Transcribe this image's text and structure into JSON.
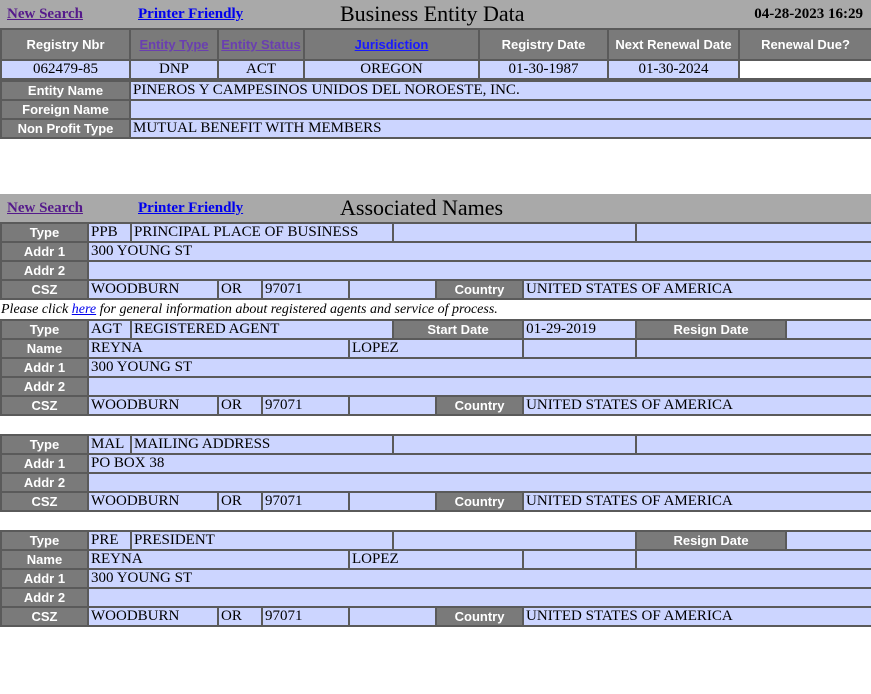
{
  "entity_section": {
    "new_search": "New Search",
    "printer_friendly": "Printer Friendly",
    "title": "Business Entity Data",
    "timestamp": "04-28-2023 16:29",
    "headers": {
      "registry_nbr": "Registry Nbr",
      "entity_type": "Entity Type",
      "entity_status": "Entity Status",
      "jurisdiction": "Jurisdiction",
      "registry_date": "Registry Date",
      "next_renewal_date": "Next Renewal Date",
      "renewal_due": "Renewal Due?"
    },
    "values": {
      "registry_nbr": "062479-85",
      "entity_type": "DNP",
      "entity_status": "ACT",
      "jurisdiction": "OREGON",
      "registry_date": "01-30-1987",
      "next_renewal_date": "01-30-2024",
      "renewal_due": ""
    },
    "entity_name_label": "Entity Name",
    "entity_name": "PINEROS Y CAMPESINOS UNIDOS DEL NOROESTE, INC.",
    "foreign_name_label": "Foreign Name",
    "foreign_name": "",
    "non_profit_type_label": "Non Profit Type",
    "non_profit_type": "MUTUAL BENEFIT WITH MEMBERS"
  },
  "associated_section": {
    "new_search": "New Search",
    "printer_friendly": "Printer Friendly",
    "title": "Associated Names"
  },
  "labels": {
    "type": "Type",
    "name": "Name",
    "addr1": "Addr 1",
    "addr2": "Addr 2",
    "csz": "CSZ",
    "country": "Country",
    "start_date": "Start Date",
    "resign_date": "Resign Date"
  },
  "agent_note": {
    "before": "Please click ",
    "link": "here",
    "after": " for general information about registered agents and service of process."
  },
  "ppb": {
    "code": "PPB",
    "desc": "PRINCIPAL PLACE OF BUSINESS",
    "addr1": "300 YOUNG ST",
    "addr2": "",
    "city": "WOODBURN",
    "state": "OR",
    "zip": "97071",
    "country": "UNITED STATES OF AMERICA"
  },
  "agt": {
    "code": "AGT",
    "desc": "REGISTERED AGENT",
    "start_date": "01-29-2019",
    "resign_date": "",
    "first_name": "REYNA",
    "last_name": "LOPEZ",
    "addr1": "300 YOUNG ST",
    "addr2": "",
    "city": "WOODBURN",
    "state": "OR",
    "zip": "97071",
    "country": "UNITED STATES OF AMERICA"
  },
  "mal": {
    "code": "MAL",
    "desc": "MAILING ADDRESS",
    "addr1": "PO BOX 38",
    "addr2": "",
    "city": "WOODBURN",
    "state": "OR",
    "zip": "97071",
    "country": "UNITED STATES OF AMERICA"
  },
  "pre": {
    "code": "PRE",
    "desc": "PRESIDENT",
    "resign_date": "",
    "first_name": "REYNA",
    "last_name": "LOPEZ",
    "addr1": "300 YOUNG ST",
    "addr2": "",
    "city": "WOODBURN",
    "state": "OR",
    "zip": "97071",
    "country": "UNITED STATES OF AMERICA"
  }
}
